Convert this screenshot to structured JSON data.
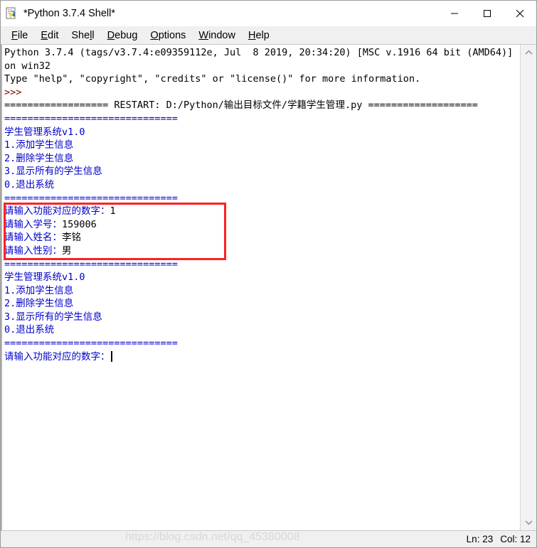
{
  "window": {
    "title": "*Python 3.7.4 Shell*",
    "icon": "python-idle-icon",
    "controls": {
      "minimize": "—",
      "maximize": "☐",
      "close": "✕"
    }
  },
  "menubar": {
    "items": [
      {
        "label": "File",
        "accel": "F"
      },
      {
        "label": "Edit",
        "accel": "E"
      },
      {
        "label": "Shell",
        "accel": "l"
      },
      {
        "label": "Debug",
        "accel": "D"
      },
      {
        "label": "Options",
        "accel": "O"
      },
      {
        "label": "Window",
        "accel": "W"
      },
      {
        "label": "Help",
        "accel": "H"
      }
    ]
  },
  "console": {
    "lines": [
      {
        "color": "black",
        "text": "Python 3.7.4 (tags/v3.7.4:e09359112e, Jul  8 2019, 20:34:20) [MSC v.1916 64 bit (AMD64)] on win32"
      },
      {
        "color": "black",
        "text": "Type \"help\", \"copyright\", \"credits\" or \"license()\" for more information."
      },
      {
        "color": "maroon",
        "text": ">>>"
      },
      {
        "color": "black",
        "text": "================== RESTART: D:/Python/输出目标文件/学籍学生管理.py ==================="
      },
      {
        "color": "blue",
        "text": "=============================="
      },
      {
        "color": "blue",
        "text": "学生管理系统v1.0"
      },
      {
        "color": "blue",
        "text": "1.添加学生信息"
      },
      {
        "color": "blue",
        "text": "2.删除学生信息"
      },
      {
        "color": "blue",
        "text": "3.显示所有的学生信息"
      },
      {
        "color": "blue",
        "text": "0.退出系统"
      },
      {
        "color": "blue",
        "text": "=============================="
      },
      {
        "color": "blue",
        "text": "请输入功能对应的数字：",
        "input": "1"
      },
      {
        "color": "blue",
        "text": "请输入学号：",
        "input": "159006"
      },
      {
        "color": "blue",
        "text": "请输入姓名：",
        "input": "李铭"
      },
      {
        "color": "blue",
        "text": "请输入性别：",
        "input": "男"
      },
      {
        "color": "blue",
        "text": "=============================="
      },
      {
        "color": "blue",
        "text": "学生管理系统v1.0"
      },
      {
        "color": "blue",
        "text": "1.添加学生信息"
      },
      {
        "color": "blue",
        "text": "2.删除学生信息"
      },
      {
        "color": "blue",
        "text": "3.显示所有的学生信息"
      },
      {
        "color": "blue",
        "text": "0.退出系统"
      },
      {
        "color": "blue",
        "text": "=============================="
      },
      {
        "color": "blue",
        "text": "请输入功能对应的数字：",
        "caret": true
      }
    ]
  },
  "annotation": {
    "type": "red-highlight-box",
    "color": "#ff2020",
    "covers_lines": "请输入功能对应的数字：1 … 请输入性别：男"
  },
  "scrollbar": {
    "up_arrow": "∧",
    "down_arrow": "∨"
  },
  "statusbar": {
    "line_label": "Ln: 23",
    "col_label": "Col: 12",
    "watermark": "https://blog.csdn.net/qq_45380008"
  }
}
